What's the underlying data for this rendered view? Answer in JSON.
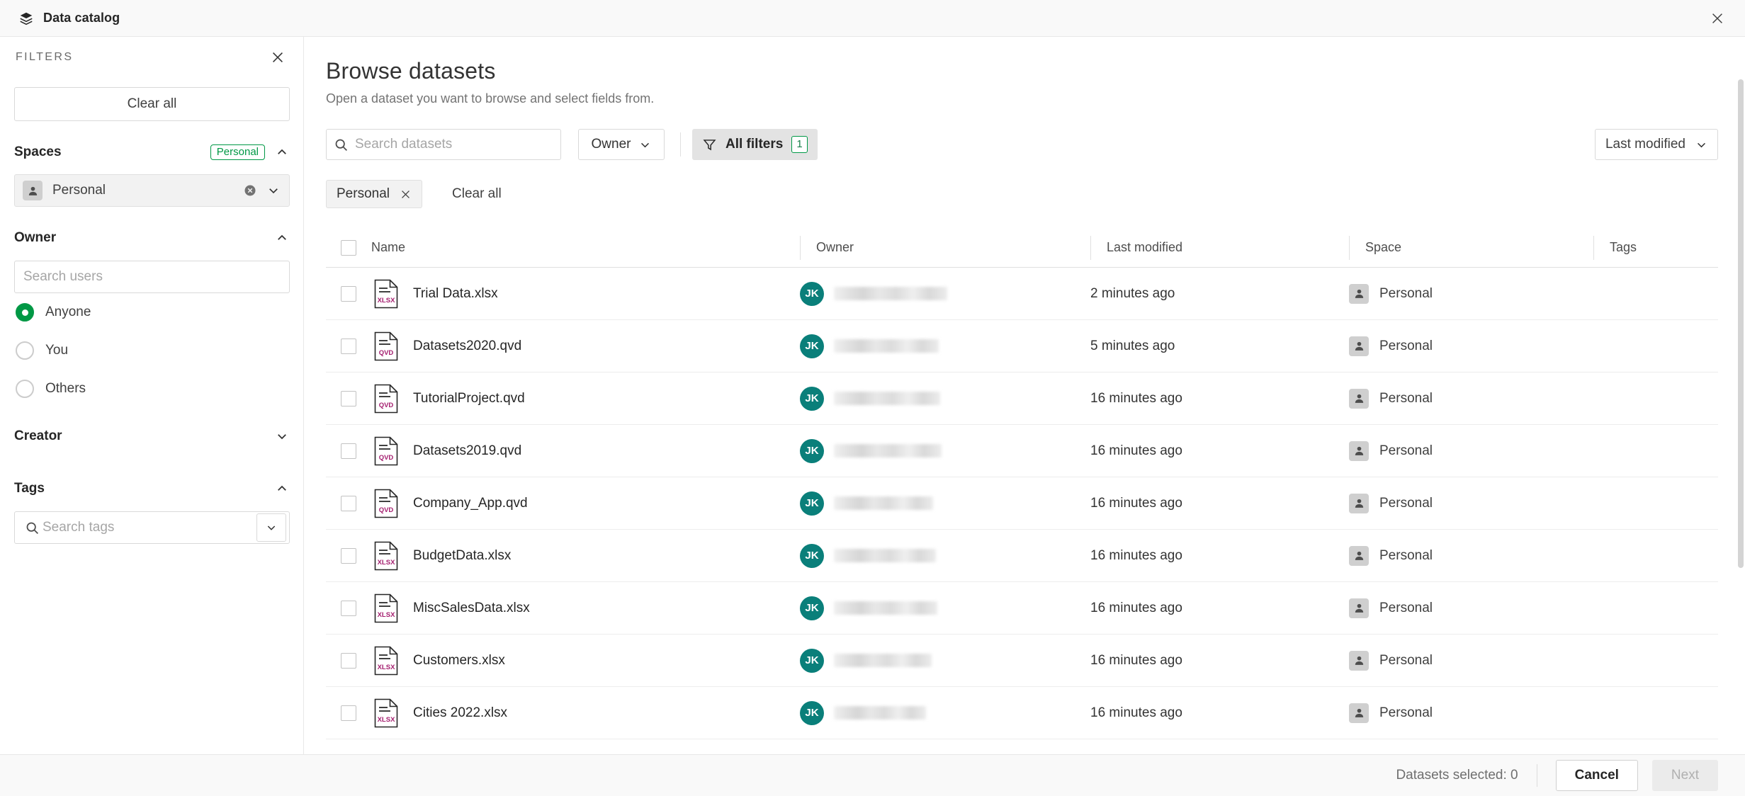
{
  "window": {
    "title": "Data catalog",
    "app_icon": "stacked-layers-icon",
    "close_icon": "close-icon"
  },
  "sidebar": {
    "heading": "FILTERS",
    "close_icon": "close-icon",
    "clear_all_label": "Clear all",
    "groups": [
      {
        "title": "Spaces",
        "badge": "Personal",
        "expanded": true,
        "chevron": "chevron-up-icon",
        "selected_space": {
          "label": "Personal",
          "avatar_icon": "person-icon",
          "clear_icon": "clear-circle-icon",
          "chevron": "chevron-down-icon"
        }
      },
      {
        "title": "Owner",
        "expanded": true,
        "chevron": "chevron-up-icon",
        "search_placeholder": "Search users",
        "search_value": "",
        "options": [
          {
            "label": "Anyone",
            "checked": true
          },
          {
            "label": "You",
            "checked": false
          },
          {
            "label": "Others",
            "checked": false
          }
        ]
      },
      {
        "title": "Creator",
        "expanded": false,
        "chevron": "chevron-down-icon"
      },
      {
        "title": "Tags",
        "expanded": true,
        "chevron": "chevron-up-icon",
        "search_placeholder": "Search tags",
        "search_value": "",
        "search_icon": "search-icon",
        "dropdown_icon": "chevron-down-icon"
      }
    ]
  },
  "main": {
    "title": "Browse datasets",
    "subtitle": "Open a dataset you want to browse and select fields from.",
    "toolbar": {
      "search_placeholder": "Search datasets",
      "search_value": "",
      "search_icon": "search-icon",
      "owner_dropdown_label": "Owner",
      "owner_dropdown_icon": "chevron-down-icon",
      "all_filters_label": "All filters",
      "all_filters_icon": "funnel-icon",
      "all_filters_count": "1",
      "sort_label": "Last modified",
      "sort_icon": "chevron-down-icon"
    },
    "chips": {
      "active": [
        {
          "label": "Personal",
          "remove_icon": "close-icon"
        }
      ],
      "clear_all_label": "Clear all"
    },
    "table": {
      "columns": [
        "Name",
        "Owner",
        "Last modified",
        "Space",
        "Tags"
      ],
      "rows": [
        {
          "name": "Trial Data.xlsx",
          "file_type": "XLSX",
          "owner_initials": "JK",
          "owner_name": "",
          "last_modified": "2 minutes ago",
          "space": "Personal",
          "tags": ""
        },
        {
          "name": "Datasets2020.qvd",
          "file_type": "QVD",
          "owner_initials": "JK",
          "owner_name": "",
          "last_modified": "5 minutes ago",
          "space": "Personal",
          "tags": ""
        },
        {
          "name": "TutorialProject.qvd",
          "file_type": "QVD",
          "owner_initials": "JK",
          "owner_name": "",
          "last_modified": "16 minutes ago",
          "space": "Personal",
          "tags": ""
        },
        {
          "name": "Datasets2019.qvd",
          "file_type": "QVD",
          "owner_initials": "JK",
          "owner_name": "",
          "last_modified": "16 minutes ago",
          "space": "Personal",
          "tags": ""
        },
        {
          "name": "Company_App.qvd",
          "file_type": "QVD",
          "owner_initials": "JK",
          "owner_name": "",
          "last_modified": "16 minutes ago",
          "space": "Personal",
          "tags": ""
        },
        {
          "name": "BudgetData.xlsx",
          "file_type": "XLSX",
          "owner_initials": "JK",
          "owner_name": "",
          "last_modified": "16 minutes ago",
          "space": "Personal",
          "tags": ""
        },
        {
          "name": "MiscSalesData.xlsx",
          "file_type": "XLSX",
          "owner_initials": "JK",
          "owner_name": "",
          "last_modified": "16 minutes ago",
          "space": "Personal",
          "tags": ""
        },
        {
          "name": "Customers.xlsx",
          "file_type": "XLSX",
          "owner_initials": "JK",
          "owner_name": "",
          "last_modified": "16 minutes ago",
          "space": "Personal",
          "tags": ""
        },
        {
          "name": "Cities 2022.xlsx",
          "file_type": "XLSX",
          "owner_initials": "JK",
          "owner_name": "",
          "last_modified": "16 minutes ago",
          "space": "Personal",
          "tags": ""
        }
      ]
    }
  },
  "footer": {
    "selected_text": "Datasets selected: 0",
    "cancel_label": "Cancel",
    "next_label": "Next"
  },
  "colors": {
    "accent_green": "#009845",
    "avatar_teal": "#0a7f7a",
    "file_label_magenta": "#a52070",
    "text_primary": "#262626",
    "text_muted": "#737373"
  }
}
